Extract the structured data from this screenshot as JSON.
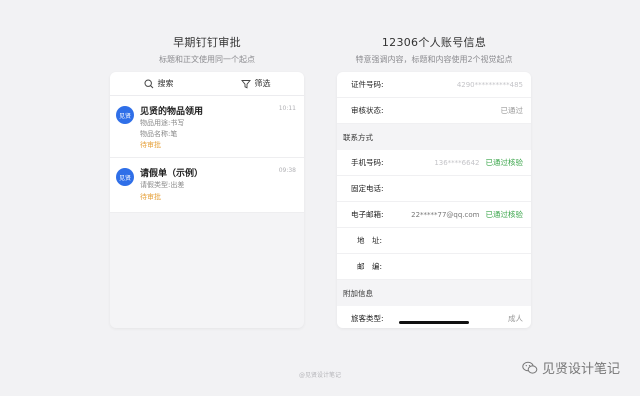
{
  "left_panel": {
    "title": "早期钉钉审批",
    "subtitle": "标题和正文使用同一个起点",
    "toolbar": {
      "search_label": "搜索",
      "filter_label": "筛选"
    },
    "items": [
      {
        "avatar": "见贤",
        "title": "见贤的物品领用",
        "time": "10:11",
        "lines": [
          "物品用途:书写",
          "物品名称:笔"
        ],
        "status": "待审批"
      },
      {
        "avatar": "见贤",
        "title": "请假单（示例）",
        "time": "09:38",
        "lines": [
          "请假类型:出差"
        ],
        "status": "待审批"
      }
    ]
  },
  "right_panel": {
    "title": "12306个人账号信息",
    "subtitle": "特意强调内容，标题和内容使用2个视觉起点",
    "rows_top": [
      {
        "label": "证件号码:",
        "value": "4290**********485"
      },
      {
        "label": "审核状态:",
        "plain": "已通过"
      }
    ],
    "section_contact": "联系方式",
    "rows_contact": [
      {
        "label": "手机号码:",
        "value": "136****6642",
        "verify": "已通过核验"
      },
      {
        "label": "固定电话:",
        "value": ""
      },
      {
        "label": "电子邮箱:",
        "value": "22*****77@qq.com",
        "verify": "已通过核验"
      },
      {
        "label": "地　址:",
        "value": ""
      },
      {
        "label": "邮　编:",
        "value": ""
      }
    ],
    "section_extra": "附加信息",
    "rows_extra": [
      {
        "label": "旅客类型:",
        "plain": "成人"
      }
    ]
  },
  "footer": "@见贤设计笔记",
  "watermark": "见贤设计笔记",
  "colors": {
    "accent_blue": "#2f6fe8",
    "pending_orange": "#e6a23c",
    "verified_green": "#3aa54a"
  }
}
